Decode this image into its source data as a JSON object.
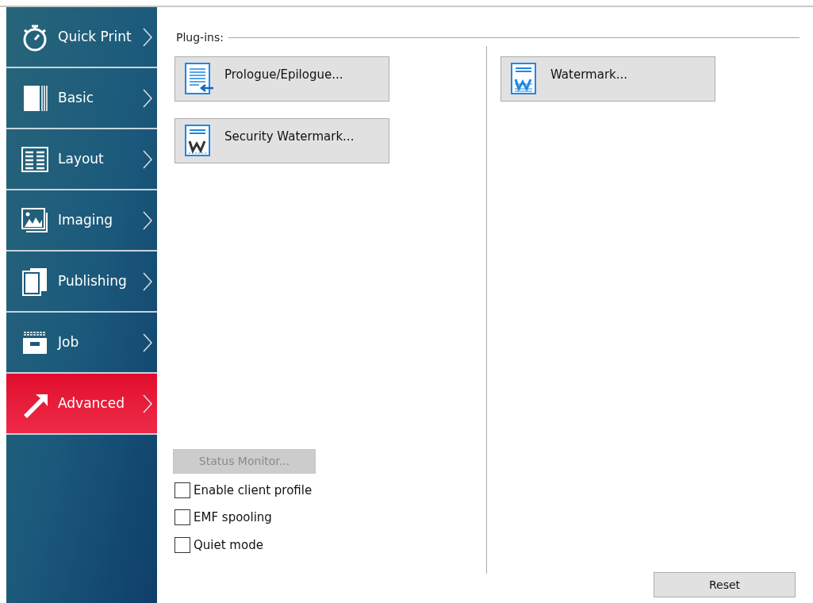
{
  "sidebar": {
    "items": [
      {
        "label": "Quick Print",
        "kind": "stopwatch",
        "selected": false
      },
      {
        "label": "Basic",
        "kind": "book",
        "selected": false
      },
      {
        "label": "Layout",
        "kind": "layout",
        "selected": false
      },
      {
        "label": "Imaging",
        "kind": "image",
        "selected": false
      },
      {
        "label": "Publishing",
        "kind": "pages",
        "selected": false
      },
      {
        "label": "Job",
        "kind": "job",
        "selected": false
      },
      {
        "label": "Advanced",
        "kind": "arrow",
        "selected": true
      }
    ]
  },
  "plugins": {
    "title": "Plug-ins:",
    "left": [
      {
        "label": "Prologue/Epilogue...",
        "kind": "prologue"
      },
      {
        "label": "Security Watermark...",
        "kind": "security"
      }
    ],
    "right": [
      {
        "label": "Watermark...",
        "kind": "watermark"
      }
    ]
  },
  "status_monitor": {
    "label": "Status Monitor...",
    "disabled": true
  },
  "options": [
    {
      "label": "Enable client profile",
      "checked": false
    },
    {
      "label": "EMF spooling",
      "checked": false
    },
    {
      "label": "Quiet mode",
      "checked": false
    }
  ],
  "reset": {
    "label": "Reset"
  }
}
